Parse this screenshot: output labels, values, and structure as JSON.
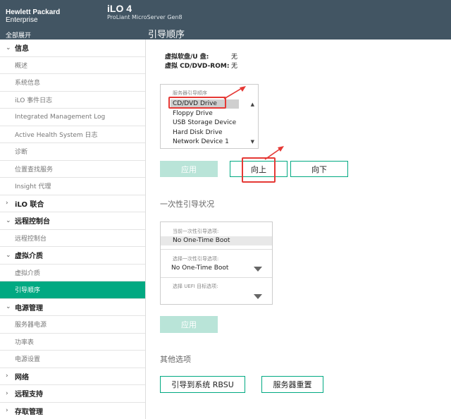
{
  "header": {
    "brand_line1": "Hewlett Packard",
    "brand_line2": "Enterprise",
    "expand_all": "全部展开",
    "product_name": "iLO 4",
    "product_sub": "ProLiant MicroServer Gen8",
    "page_title": "引导顺序"
  },
  "sidebar": {
    "sections": [
      {
        "label": "信息",
        "expanded": true
      },
      {
        "label": "iLO 联合",
        "expanded": false
      },
      {
        "label": "远程控制台",
        "expanded": true
      },
      {
        "label": "虚拟介质",
        "expanded": true
      },
      {
        "label": "电源管理",
        "expanded": true
      },
      {
        "label": "网络",
        "expanded": false
      },
      {
        "label": "远程支持",
        "expanded": false
      },
      {
        "label": "存取管理",
        "expanded": false
      }
    ],
    "items": {
      "info": [
        "概述",
        "系统信息",
        "iLO 事件日志",
        "Integrated Management Log",
        "Active Health System 日志",
        "诊断",
        "位置查找服务",
        "Insight 代理"
      ],
      "remote_console": [
        "远程控制台"
      ],
      "virtual_media": [
        "虚拟介质",
        "引导顺序"
      ],
      "power": [
        "服务器电源",
        "功率表",
        "电源设置"
      ]
    },
    "chevron_expanded": "⌄",
    "chevron_collapsed": "›"
  },
  "main": {
    "virtual_floppy_label": "虚拟软盘/U 盘:",
    "virtual_floppy_value": "无",
    "virtual_cd_label": "虚拟 CD/DVD-ROM:",
    "virtual_cd_value": "无",
    "boot_order_caption": "服务器引导顺序",
    "boot_order": [
      "CD/DVD Drive",
      "Floppy Drive",
      "USB Storage Device",
      "Hard Disk Drive",
      "Network Device 1"
    ],
    "apply_label": "应用",
    "up_label": "向上",
    "down_label": "向下",
    "one_time_title": "一次性引导状况",
    "current_one_time_caption": "当前一次性引导选项:",
    "current_one_time_value": "No One-Time Boot",
    "select_one_time_caption": "选择一次性引导选项:",
    "select_one_time_value": "No One-Time Boot",
    "select_uefi_caption": "选择 UEFI 目标选项:",
    "apply2_label": "应用",
    "other_title": "其他选项",
    "rbsu_label": "引导到系统 RBSU",
    "reset_label": "服务器重置"
  },
  "colors": {
    "header_bg": "#425563",
    "accent": "#01a982",
    "annotation": "#e53935"
  }
}
